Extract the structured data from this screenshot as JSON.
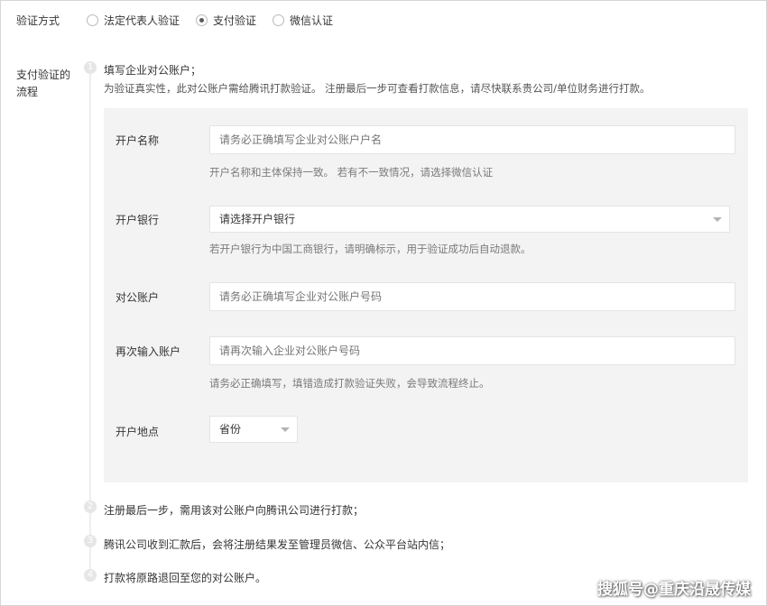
{
  "verify": {
    "label": "验证方式",
    "options": [
      {
        "label": "法定代表人验证",
        "checked": false
      },
      {
        "label": "支付验证",
        "checked": true
      },
      {
        "label": "微信认证",
        "checked": false
      }
    ]
  },
  "flow": {
    "label_line1": "支付验证的",
    "label_line2": "流程",
    "steps": [
      {
        "num": "1",
        "text": "填写企业对公账户；",
        "sub": "为验证真实性，此对公账户需给腾讯打款验证。 注册最后一步可查看打款信息，请尽快联系贵公司/单位财务进行打款。"
      },
      {
        "num": "2",
        "text": "注册最后一步，需用该对公账户向腾讯公司进行打款；"
      },
      {
        "num": "3",
        "text": "腾讯公司收到汇款后，会将注册结果发至管理员微信、公众平台站内信；"
      },
      {
        "num": "4",
        "text": "打款将原路退回至您的对公账户。"
      }
    ]
  },
  "form": {
    "account_name": {
      "label": "开户名称",
      "placeholder": "请务必正确填写企业对公账户户名",
      "hint": "开户名称和主体保持一致。 若有不一致情况，请选择微信认证"
    },
    "bank": {
      "label": "开户银行",
      "value": "请选择开户银行",
      "hint": "若开户银行为中国工商银行，请明确标示，用于验证成功后自动退款。"
    },
    "account": {
      "label": "对公账户",
      "placeholder": "请务必正确填写企业对公账户号码"
    },
    "account_confirm": {
      "label": "再次输入账户",
      "placeholder": "请再次输入企业对公账户号码",
      "hint": "请务必正确填写，填错造成打款验证失败，会导致流程终止。"
    },
    "location": {
      "label": "开户地点",
      "value": "省份"
    }
  },
  "watermark": "搜狐号@重庆沿晟传媒"
}
